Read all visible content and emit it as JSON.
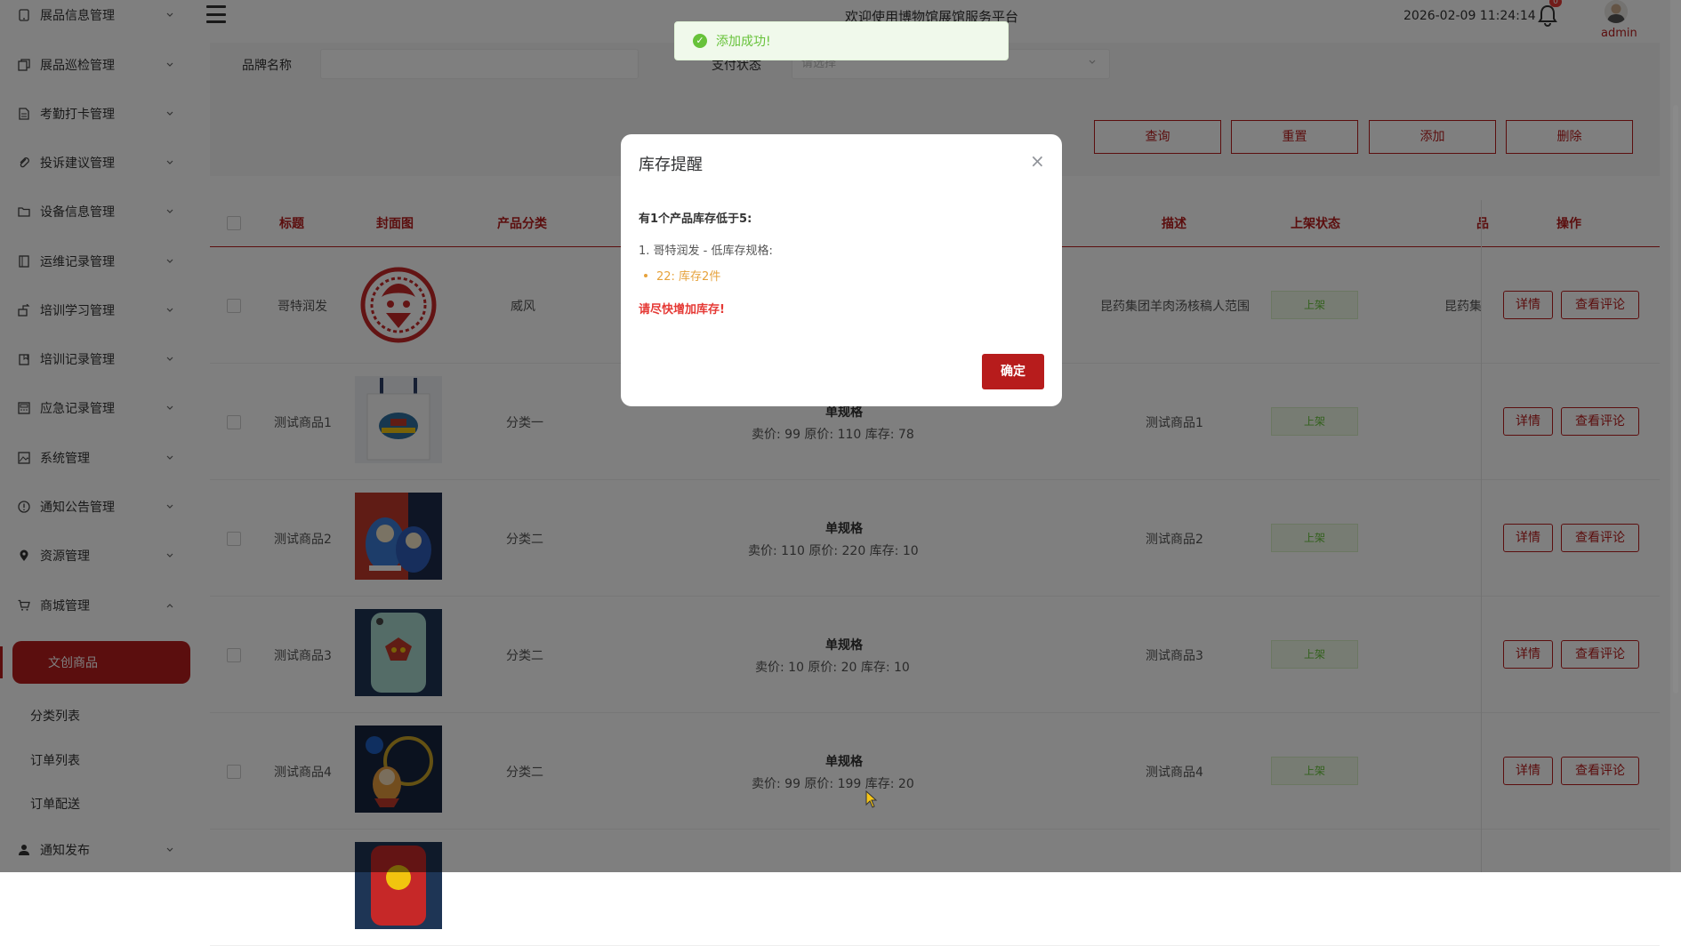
{
  "sidebar": {
    "items": [
      {
        "label": "展品信息管理",
        "icon": "tablet-icon"
      },
      {
        "label": "展品巡检管理",
        "icon": "copy-icon"
      },
      {
        "label": "考勤打卡管理",
        "icon": "document-icon"
      },
      {
        "label": "投诉建议管理",
        "icon": "paperclip-icon"
      },
      {
        "label": "设备信息管理",
        "icon": "folder-icon"
      },
      {
        "label": "运维记录管理",
        "icon": "notebook-icon"
      },
      {
        "label": "培训学习管理",
        "icon": "share-icon"
      },
      {
        "label": "培训记录管理",
        "icon": "bookmark-icon"
      },
      {
        "label": "应急记录管理",
        "icon": "calculator-icon"
      },
      {
        "label": "系统管理",
        "icon": "picture-icon"
      },
      {
        "label": "通知公告管理",
        "icon": "info-icon"
      },
      {
        "label": "资源管理",
        "icon": "location-icon"
      },
      {
        "label": "商城管理",
        "icon": "cart-icon"
      }
    ],
    "mall_sub": {
      "active": "文创商品",
      "items": [
        "分类列表",
        "订单列表",
        "订单配送"
      ]
    },
    "last_item": {
      "label": "通知发布",
      "icon": "user-icon"
    }
  },
  "header": {
    "welcome": "欢迎使用博物馆展馆服务平台",
    "datetime": "2026-02-09 11:24:14",
    "badge": "0",
    "user": "admin"
  },
  "search": {
    "brand_label": "品牌名称",
    "pay_label": "支付状态",
    "pay_placeholder": "请选择",
    "buttons": {
      "query": "查询",
      "reset": "重置",
      "add": "添加",
      "delete": "删除"
    }
  },
  "table": {
    "headers": {
      "title": "标题",
      "cover": "封面图",
      "category": "产品分类",
      "desc": "描述",
      "status": "上架状态",
      "brand": "品",
      "actions": "操作"
    },
    "rows": [
      {
        "title": "哥特润发",
        "category": "威风",
        "spec_title": "",
        "spec_detail": "",
        "desc": "昆药集团羊肉汤核稿人范围",
        "status": "上架",
        "brand": "昆药集",
        "detail": "详情",
        "comments": "查看评论"
      },
      {
        "title": "测试商品1",
        "category": "分类一",
        "spec_title": "单规格",
        "spec_detail": "卖价: 99  原价: 110  库存: 78",
        "desc": "测试商品1",
        "status": "上架",
        "brand": "",
        "detail": "详情",
        "comments": "查看评论"
      },
      {
        "title": "测试商品2",
        "category": "分类二",
        "spec_title": "单规格",
        "spec_detail": "卖价: 110  原价: 220  库存: 10",
        "desc": "测试商品2",
        "status": "上架",
        "brand": "",
        "detail": "详情",
        "comments": "查看评论"
      },
      {
        "title": "测试商品3",
        "category": "分类二",
        "spec_title": "单规格",
        "spec_detail": "卖价: 10  原价: 20  库存: 10",
        "desc": "测试商品3",
        "status": "上架",
        "brand": "",
        "detail": "详情",
        "comments": "查看评论"
      },
      {
        "title": "测试商品4",
        "category": "分类二",
        "spec_title": "单规格",
        "spec_detail": "卖价: 99  原价: 199  库存: 20",
        "desc": "测试商品4",
        "status": "上架",
        "brand": "",
        "detail": "详情",
        "comments": "查看评论"
      }
    ]
  },
  "toast": {
    "text": "添加成功!"
  },
  "modal": {
    "title": "库存提醒",
    "heading": "有1个产品库存低于5:",
    "line": "1. 哥特润发 - 低库存规格:",
    "bullet": "22: 库存2件",
    "warning": "请尽快增加库存!",
    "ok": "确定"
  },
  "colors": {
    "accent": "#b71c1c",
    "success": "#67c23a",
    "warning": "#e6a23c",
    "danger": "#e53935"
  }
}
